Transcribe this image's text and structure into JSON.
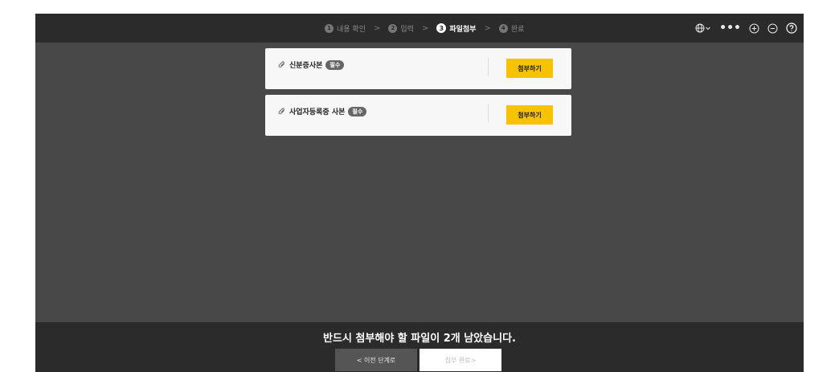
{
  "steps": [
    {
      "num": "1",
      "label": "내용 확인"
    },
    {
      "num": "2",
      "label": "입력"
    },
    {
      "num": "3",
      "label": "파일첨부"
    },
    {
      "num": "4",
      "label": "완료"
    }
  ],
  "step_separator": ">",
  "toolbar": {
    "language_icon": "globe-icon",
    "more_label": "•••",
    "zoom_in_icon": "plus-circle-icon",
    "zoom_out_icon": "minus-circle-icon",
    "help_icon": "help-icon"
  },
  "documents": [
    {
      "title": "신분증사본",
      "badge": "필수",
      "button": "첨부하기"
    },
    {
      "title": "사업자등록증 사본",
      "badge": "필수",
      "button": "첨부하기"
    }
  ],
  "footer": {
    "notice": "반드시 첨부해야 할 파일이 2개 남았습니다.",
    "prev_button": "< 이전 단계로",
    "done_button": "첨부 완료>"
  },
  "colors": {
    "accent": "#f7c200",
    "topbar": "#2b2b2b",
    "background": "#484848"
  }
}
